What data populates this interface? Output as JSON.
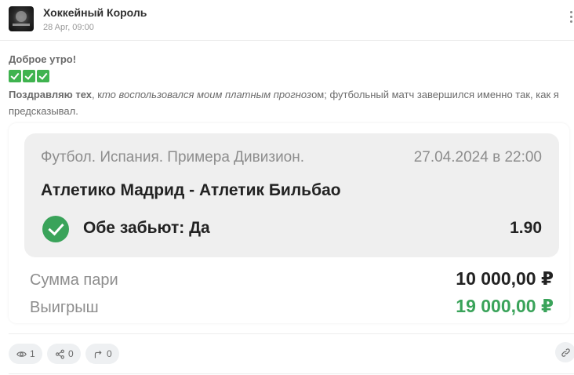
{
  "post": {
    "author": "Хоккейный Король",
    "date": "28 Apr, 09:00",
    "avatar_icon": "hockey-king-logo",
    "menu_icon": "kebab-menu-icon"
  },
  "message": {
    "greeting": "Доброе утро!",
    "emoji": [
      "✅",
      "✅",
      "✅"
    ],
    "text_bold": "Поздравляю тех",
    "text_sep": ", к",
    "text_italic": "то воспользовался моим платным прогноз",
    "text_rest": "ом; футбольный матч завершился именно так, как я предсказывал."
  },
  "bet": {
    "league": "Футбол. Испания. Примера Дивизион.",
    "event_date": "27.04.2024 в 22:00",
    "match": "Атлетико Мадрид - Атлетик Бильбао",
    "outcome": "Обе забьют: Да",
    "odds": "1.90",
    "status_icon": "check-circle-icon",
    "status_color": "#3aa35a",
    "stake_label": "Сумма пари",
    "stake_value": "10 000,00 ₽",
    "win_label": "Выигрыш",
    "win_value": "19 000,00 ₽",
    "win_color": "#3aa35a"
  },
  "footer": {
    "views_count": "1",
    "reposts_count": "0",
    "shares_count": "0",
    "views_icon": "eye-icon",
    "reposts_icon": "share-nodes-icon",
    "shares_icon": "forward-arrow-icon",
    "link_icon": "link-icon"
  }
}
